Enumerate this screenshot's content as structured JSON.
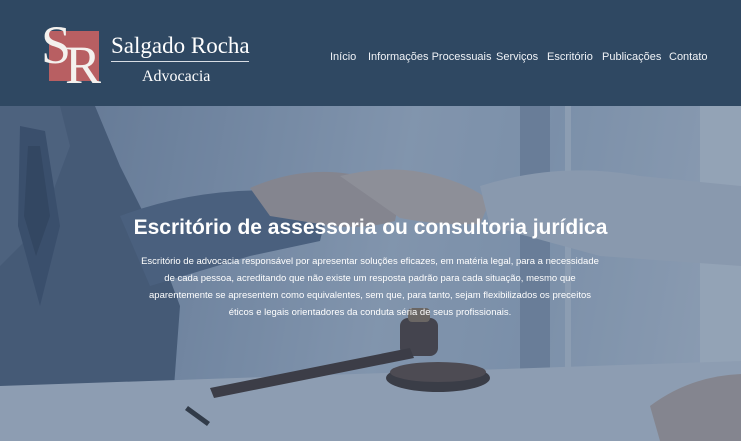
{
  "brand": {
    "initial_s": "S",
    "initial_r": "R",
    "name": "Salgado Rocha",
    "subtitle": "Advocacia",
    "accent_color": "#b85f62"
  },
  "nav": {
    "items": [
      {
        "label": "Início"
      },
      {
        "label": "Informações Processuais"
      },
      {
        "label": "Serviços"
      },
      {
        "label": "Escritório"
      },
      {
        "label": "Publicações"
      },
      {
        "label": "Contato"
      }
    ]
  },
  "hero": {
    "title": "Escritório de assessoria ou consultoria jurídica",
    "description": "Escritório de advocacia responsável por apresentar soluções eficazes, em matéria legal, para a necessidade de cada pessoa, acreditando que não existe um resposta padrão para cada situação, mesmo que aparentemente se apresentem como equivalentes, sem que, para tanto, sejam flexibilizados os preceitos éticos e legais orientadores da conduta séria de seus profissionais."
  },
  "colors": {
    "header_bg": "#2f4862",
    "hero_overlay": "#3c5474"
  }
}
